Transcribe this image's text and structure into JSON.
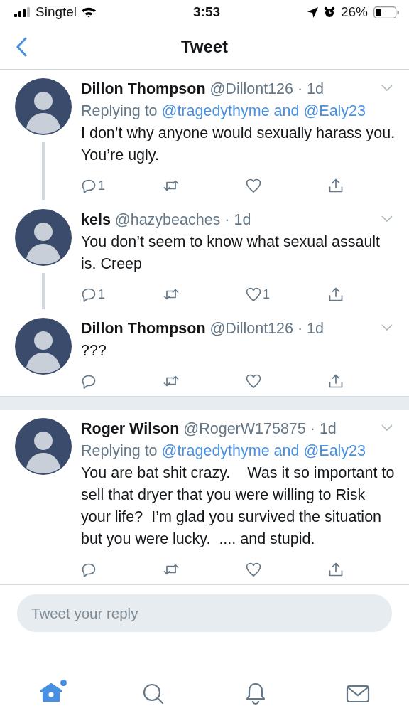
{
  "status_bar": {
    "carrier": "Singtel",
    "time": "3:53",
    "battery": "26%"
  },
  "nav_bar": {
    "title": "Tweet"
  },
  "threads": [
    {
      "tweets": [
        {
          "name": "Dillon Thompson",
          "handle_time": "@Dillont126 · 1d",
          "replying": {
            "prefix": "Replying to",
            "targets": "@tragedythyme and @Ealy23"
          },
          "text": "I don’t why anyone would sexually harass you. You’re ugly.",
          "thread_line": true,
          "actions": [
            {
              "kind": "reply",
              "count": "1"
            },
            {
              "kind": "retweet"
            },
            {
              "kind": "like"
            },
            {
              "kind": "share"
            }
          ]
        },
        {
          "name": "kels",
          "handle_time": "@hazybeaches · 1d",
          "text": "You don’t seem to know what sexual assault is. Creep",
          "thread_line": true,
          "actions": [
            {
              "kind": "reply",
              "count": "1"
            },
            {
              "kind": "retweet"
            },
            {
              "kind": "like",
              "count": "1"
            },
            {
              "kind": "share"
            }
          ]
        },
        {
          "name": "Dillon Thompson",
          "handle_time": "@Dillont126 · 1d",
          "text": "???",
          "thread_line": false,
          "actions": [
            {
              "kind": "reply"
            },
            {
              "kind": "retweet"
            },
            {
              "kind": "like"
            },
            {
              "kind": "share"
            }
          ]
        }
      ]
    },
    {
      "tweets": [
        {
          "name": "Roger Wilson",
          "handle_time": "@RogerW175875 · 1d",
          "replying": {
            "prefix": "Replying to",
            "targets": "@tragedythyme and @Ealy23"
          },
          "text": "You are bat shit crazy.    Was it so important to sell that dryer that you were willing to Risk your life?  I’m glad you survived the situation but you were lucky.  .... and stupid.",
          "thread_line": false,
          "actions": [
            {
              "kind": "reply"
            },
            {
              "kind": "retweet"
            },
            {
              "kind": "like"
            },
            {
              "kind": "share"
            }
          ]
        }
      ]
    }
  ],
  "reply_box": {
    "placeholder": "Tweet your reply"
  },
  "tab_bar": [
    {
      "kind": "home",
      "selected": true,
      "new_dot": true
    },
    {
      "kind": "search",
      "selected": false,
      "new_dot": false
    },
    {
      "kind": "notifications",
      "selected": false,
      "new_dot": false
    },
    {
      "kind": "messages",
      "selected": false,
      "new_dot": false
    }
  ]
}
